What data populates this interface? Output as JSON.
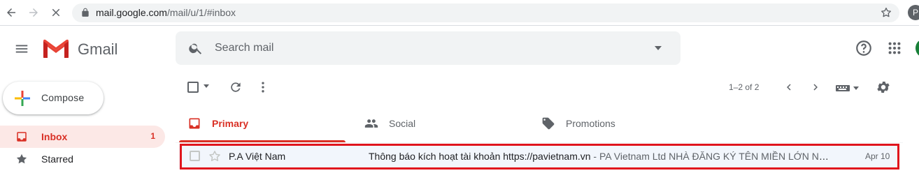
{
  "browser": {
    "url_host": "mail.google.com",
    "url_path": "/mail/u/1/#inbox",
    "profile_initial": "P"
  },
  "app": {
    "brand": "Gmail",
    "search_placeholder": "Search mail"
  },
  "sidebar": {
    "compose_label": "Compose",
    "items": [
      {
        "label": "Inbox",
        "count": "1",
        "icon": "inbox-icon",
        "active": true
      },
      {
        "label": "Starred",
        "count": "",
        "icon": "star-icon",
        "active": false
      }
    ]
  },
  "toolbar": {
    "pager_text": "1–2 of 2"
  },
  "tabs": [
    {
      "label": "Primary",
      "icon": "inbox-icon",
      "selected": true
    },
    {
      "label": "Social",
      "icon": "people-icon",
      "selected": false
    },
    {
      "label": "Promotions",
      "icon": "tag-icon",
      "selected": false
    }
  ],
  "emails": [
    {
      "sender": "P.A Việt Nam",
      "subject": "Thông báo kích hoạt tài khoản https://pavietnam.vn",
      "separator": " - ",
      "preview": "PA Vietnam Ltd NHÀ ĐĂNG KÝ TÊN MIỀN LỚN NHẤT VIỆT NAM",
      "date": "Apr 10"
    }
  ],
  "colors": {
    "accent_red": "#d93025",
    "highlight_border": "#e0151d",
    "search_bg": "#f1f3f4"
  }
}
